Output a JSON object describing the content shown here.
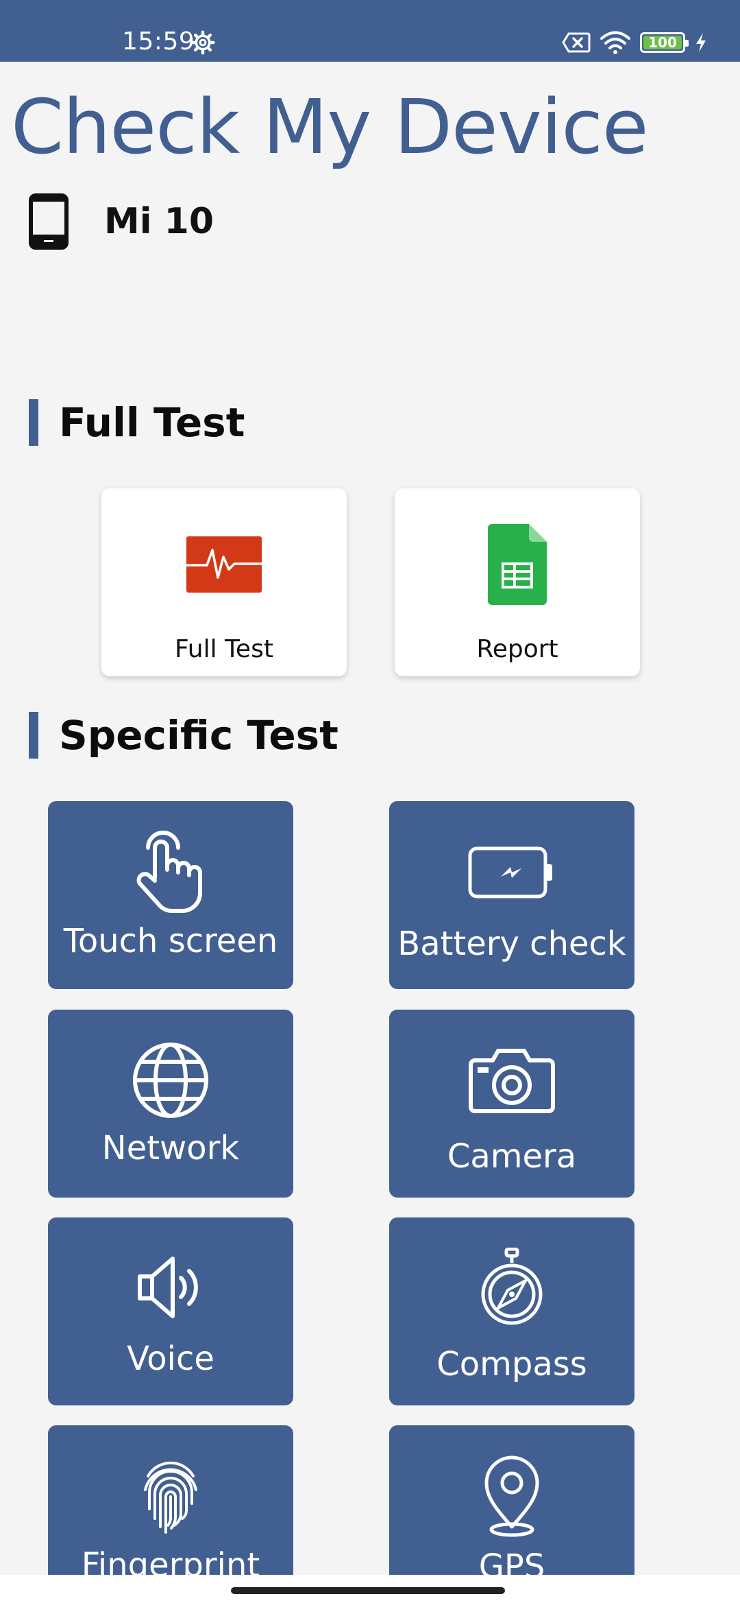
{
  "status_bar": {
    "time": "15:59",
    "battery_level": "100",
    "icons": [
      "gear-icon",
      "close-box-icon",
      "wifi-icon",
      "battery-icon",
      "charging-bolt-icon"
    ]
  },
  "header": {
    "title": "Check My Device",
    "device_name": "Mi 10",
    "device_icon": "smartphone-icon"
  },
  "full_test_section": {
    "title": "Full Test",
    "cards": [
      {
        "label": "Full Test",
        "icon": "heartbeat-monitor-icon",
        "color": "#d23a17"
      },
      {
        "label": "Report",
        "icon": "spreadsheet-icon",
        "color": "#28b04a"
      }
    ]
  },
  "specific_test_section": {
    "title": "Specific Test",
    "tiles": [
      {
        "label": "Touch screen",
        "icon": "touch-hand-icon"
      },
      {
        "label": "Battery check",
        "icon": "battery-charging-icon"
      },
      {
        "label": "Network",
        "icon": "globe-icon"
      },
      {
        "label": "Camera",
        "icon": "camera-icon"
      },
      {
        "label": "Voice",
        "icon": "speaker-icon"
      },
      {
        "label": "Compass",
        "icon": "compass-icon"
      },
      {
        "label": "Fingerprint",
        "icon": "fingerprint-icon"
      },
      {
        "label": "GPS",
        "icon": "location-pin-icon"
      }
    ]
  },
  "colors": {
    "brand": "#425f91",
    "background": "#f4f4f4"
  }
}
